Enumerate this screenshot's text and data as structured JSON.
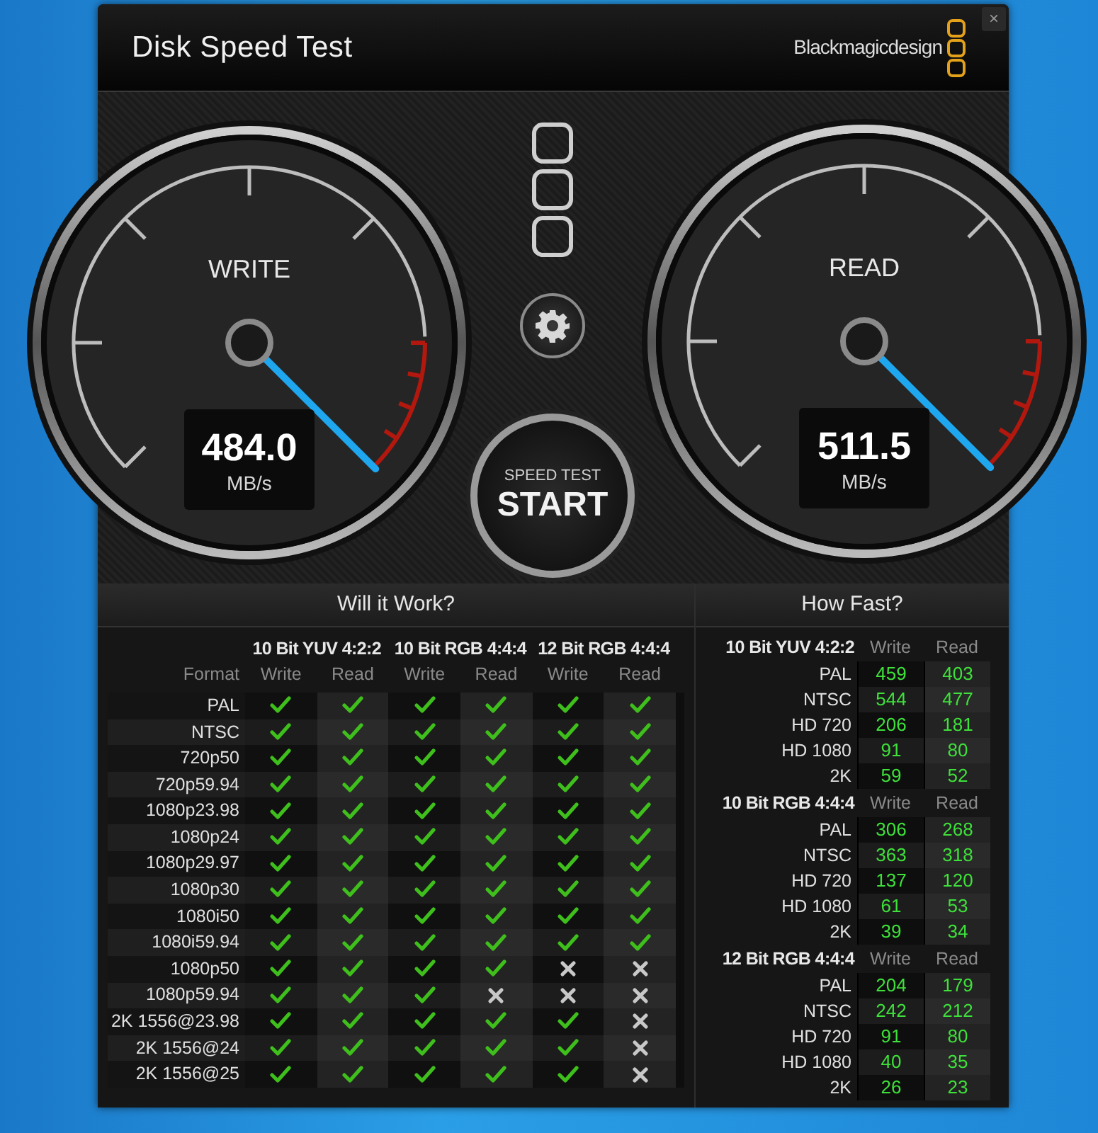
{
  "window": {
    "title": "Disk Speed Test",
    "brand": "Blackmagicdesign",
    "close": "×"
  },
  "gauges": [
    {
      "label": "WRITE",
      "value": "484.0",
      "unit": "MB/s",
      "level": 1.0
    },
    {
      "label": "READ",
      "value": "511.5",
      "unit": "MB/s",
      "level": 1.0
    }
  ],
  "start_button": {
    "caption": "SPEED TEST",
    "label": "START"
  },
  "will_it_work": {
    "title": "Will it Work?",
    "format_label": "Format",
    "groups": [
      "10 Bit YUV 4:2:2",
      "10 Bit RGB 4:4:4",
      "12 Bit RGB 4:4:4"
    ],
    "subcolumns": [
      "Write",
      "Read",
      "Write",
      "Read",
      "Write",
      "Read"
    ],
    "rows": [
      {
        "format": "PAL",
        "results": [
          true,
          true,
          true,
          true,
          true,
          true
        ]
      },
      {
        "format": "NTSC",
        "results": [
          true,
          true,
          true,
          true,
          true,
          true
        ]
      },
      {
        "format": "720p50",
        "results": [
          true,
          true,
          true,
          true,
          true,
          true
        ]
      },
      {
        "format": "720p59.94",
        "results": [
          true,
          true,
          true,
          true,
          true,
          true
        ]
      },
      {
        "format": "1080p23.98",
        "results": [
          true,
          true,
          true,
          true,
          true,
          true
        ]
      },
      {
        "format": "1080p24",
        "results": [
          true,
          true,
          true,
          true,
          true,
          true
        ]
      },
      {
        "format": "1080p29.97",
        "results": [
          true,
          true,
          true,
          true,
          true,
          true
        ]
      },
      {
        "format": "1080p30",
        "results": [
          true,
          true,
          true,
          true,
          true,
          true
        ]
      },
      {
        "format": "1080i50",
        "results": [
          true,
          true,
          true,
          true,
          true,
          true
        ]
      },
      {
        "format": "1080i59.94",
        "results": [
          true,
          true,
          true,
          true,
          true,
          true
        ]
      },
      {
        "format": "1080p50",
        "results": [
          true,
          true,
          true,
          true,
          false,
          false
        ]
      },
      {
        "format": "1080p59.94",
        "results": [
          true,
          true,
          true,
          false,
          false,
          false
        ]
      },
      {
        "format": "2K 1556@23.98",
        "results": [
          true,
          true,
          true,
          true,
          true,
          false
        ]
      },
      {
        "format": "2K 1556@24",
        "results": [
          true,
          true,
          true,
          true,
          true,
          false
        ]
      },
      {
        "format": "2K 1556@25",
        "results": [
          true,
          true,
          true,
          true,
          true,
          false
        ]
      }
    ]
  },
  "how_fast": {
    "title": "How Fast?",
    "sections": [
      {
        "name": "10 Bit YUV 4:2:2",
        "write_label": "Write",
        "read_label": "Read",
        "rows": [
          {
            "format": "PAL",
            "write": "459",
            "read": "403"
          },
          {
            "format": "NTSC",
            "write": "544",
            "read": "477"
          },
          {
            "format": "HD 720",
            "write": "206",
            "read": "181"
          },
          {
            "format": "HD 1080",
            "write": "91",
            "read": "80"
          },
          {
            "format": "2K",
            "write": "59",
            "read": "52"
          }
        ]
      },
      {
        "name": "10 Bit RGB 4:4:4",
        "write_label": "Write",
        "read_label": "Read",
        "rows": [
          {
            "format": "PAL",
            "write": "306",
            "read": "268"
          },
          {
            "format": "NTSC",
            "write": "363",
            "read": "318"
          },
          {
            "format": "HD 720",
            "write": "137",
            "read": "120"
          },
          {
            "format": "HD 1080",
            "write": "61",
            "read": "53"
          },
          {
            "format": "2K",
            "write": "39",
            "read": "34"
          }
        ]
      },
      {
        "name": "12 Bit RGB 4:4:4",
        "write_label": "Write",
        "read_label": "Read",
        "rows": [
          {
            "format": "PAL",
            "write": "204",
            "read": "179"
          },
          {
            "format": "NTSC",
            "write": "242",
            "read": "212"
          },
          {
            "format": "HD 720",
            "write": "91",
            "read": "80"
          },
          {
            "format": "HD 1080",
            "write": "40",
            "read": "35"
          },
          {
            "format": "2K",
            "write": "26",
            "read": "23"
          }
        ]
      }
    ]
  }
}
